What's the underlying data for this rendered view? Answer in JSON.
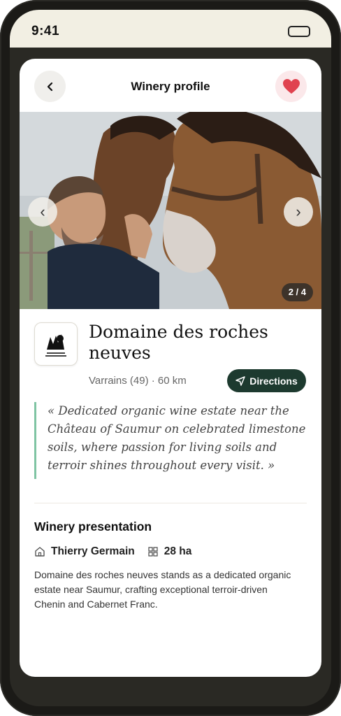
{
  "status": {
    "time": "9:41"
  },
  "header": {
    "title": "Winery profile"
  },
  "gallery": {
    "counter": "2 / 4",
    "prev_glyph": "‹",
    "next_glyph": "›"
  },
  "winery": {
    "name": "Domaine des roches neuves",
    "location": "Varrains (49) · 60 km",
    "directions_label": "Directions",
    "quote": "« Dedicated organic wine estate near the Château of Saumur on celebrated limestone soils, where passion for living soils and terroir shines throughout every visit. »"
  },
  "presentation": {
    "title": "Winery presentation",
    "owner": "Thierry Germain",
    "area": "28 ha",
    "description": "Domaine des roches neuves stands as a dedicated organic estate near Saumur, crafting exceptional terroir-driven Chenin and Cabernet Franc."
  },
  "colors": {
    "accent_dark": "#1d3a2f",
    "quote_bar": "#7fc4a3",
    "favorite": "#e0424f"
  },
  "icons": [
    "back-arrow-icon",
    "heart-icon",
    "navigation-arrow-icon",
    "home-icon",
    "grid-icon"
  ]
}
